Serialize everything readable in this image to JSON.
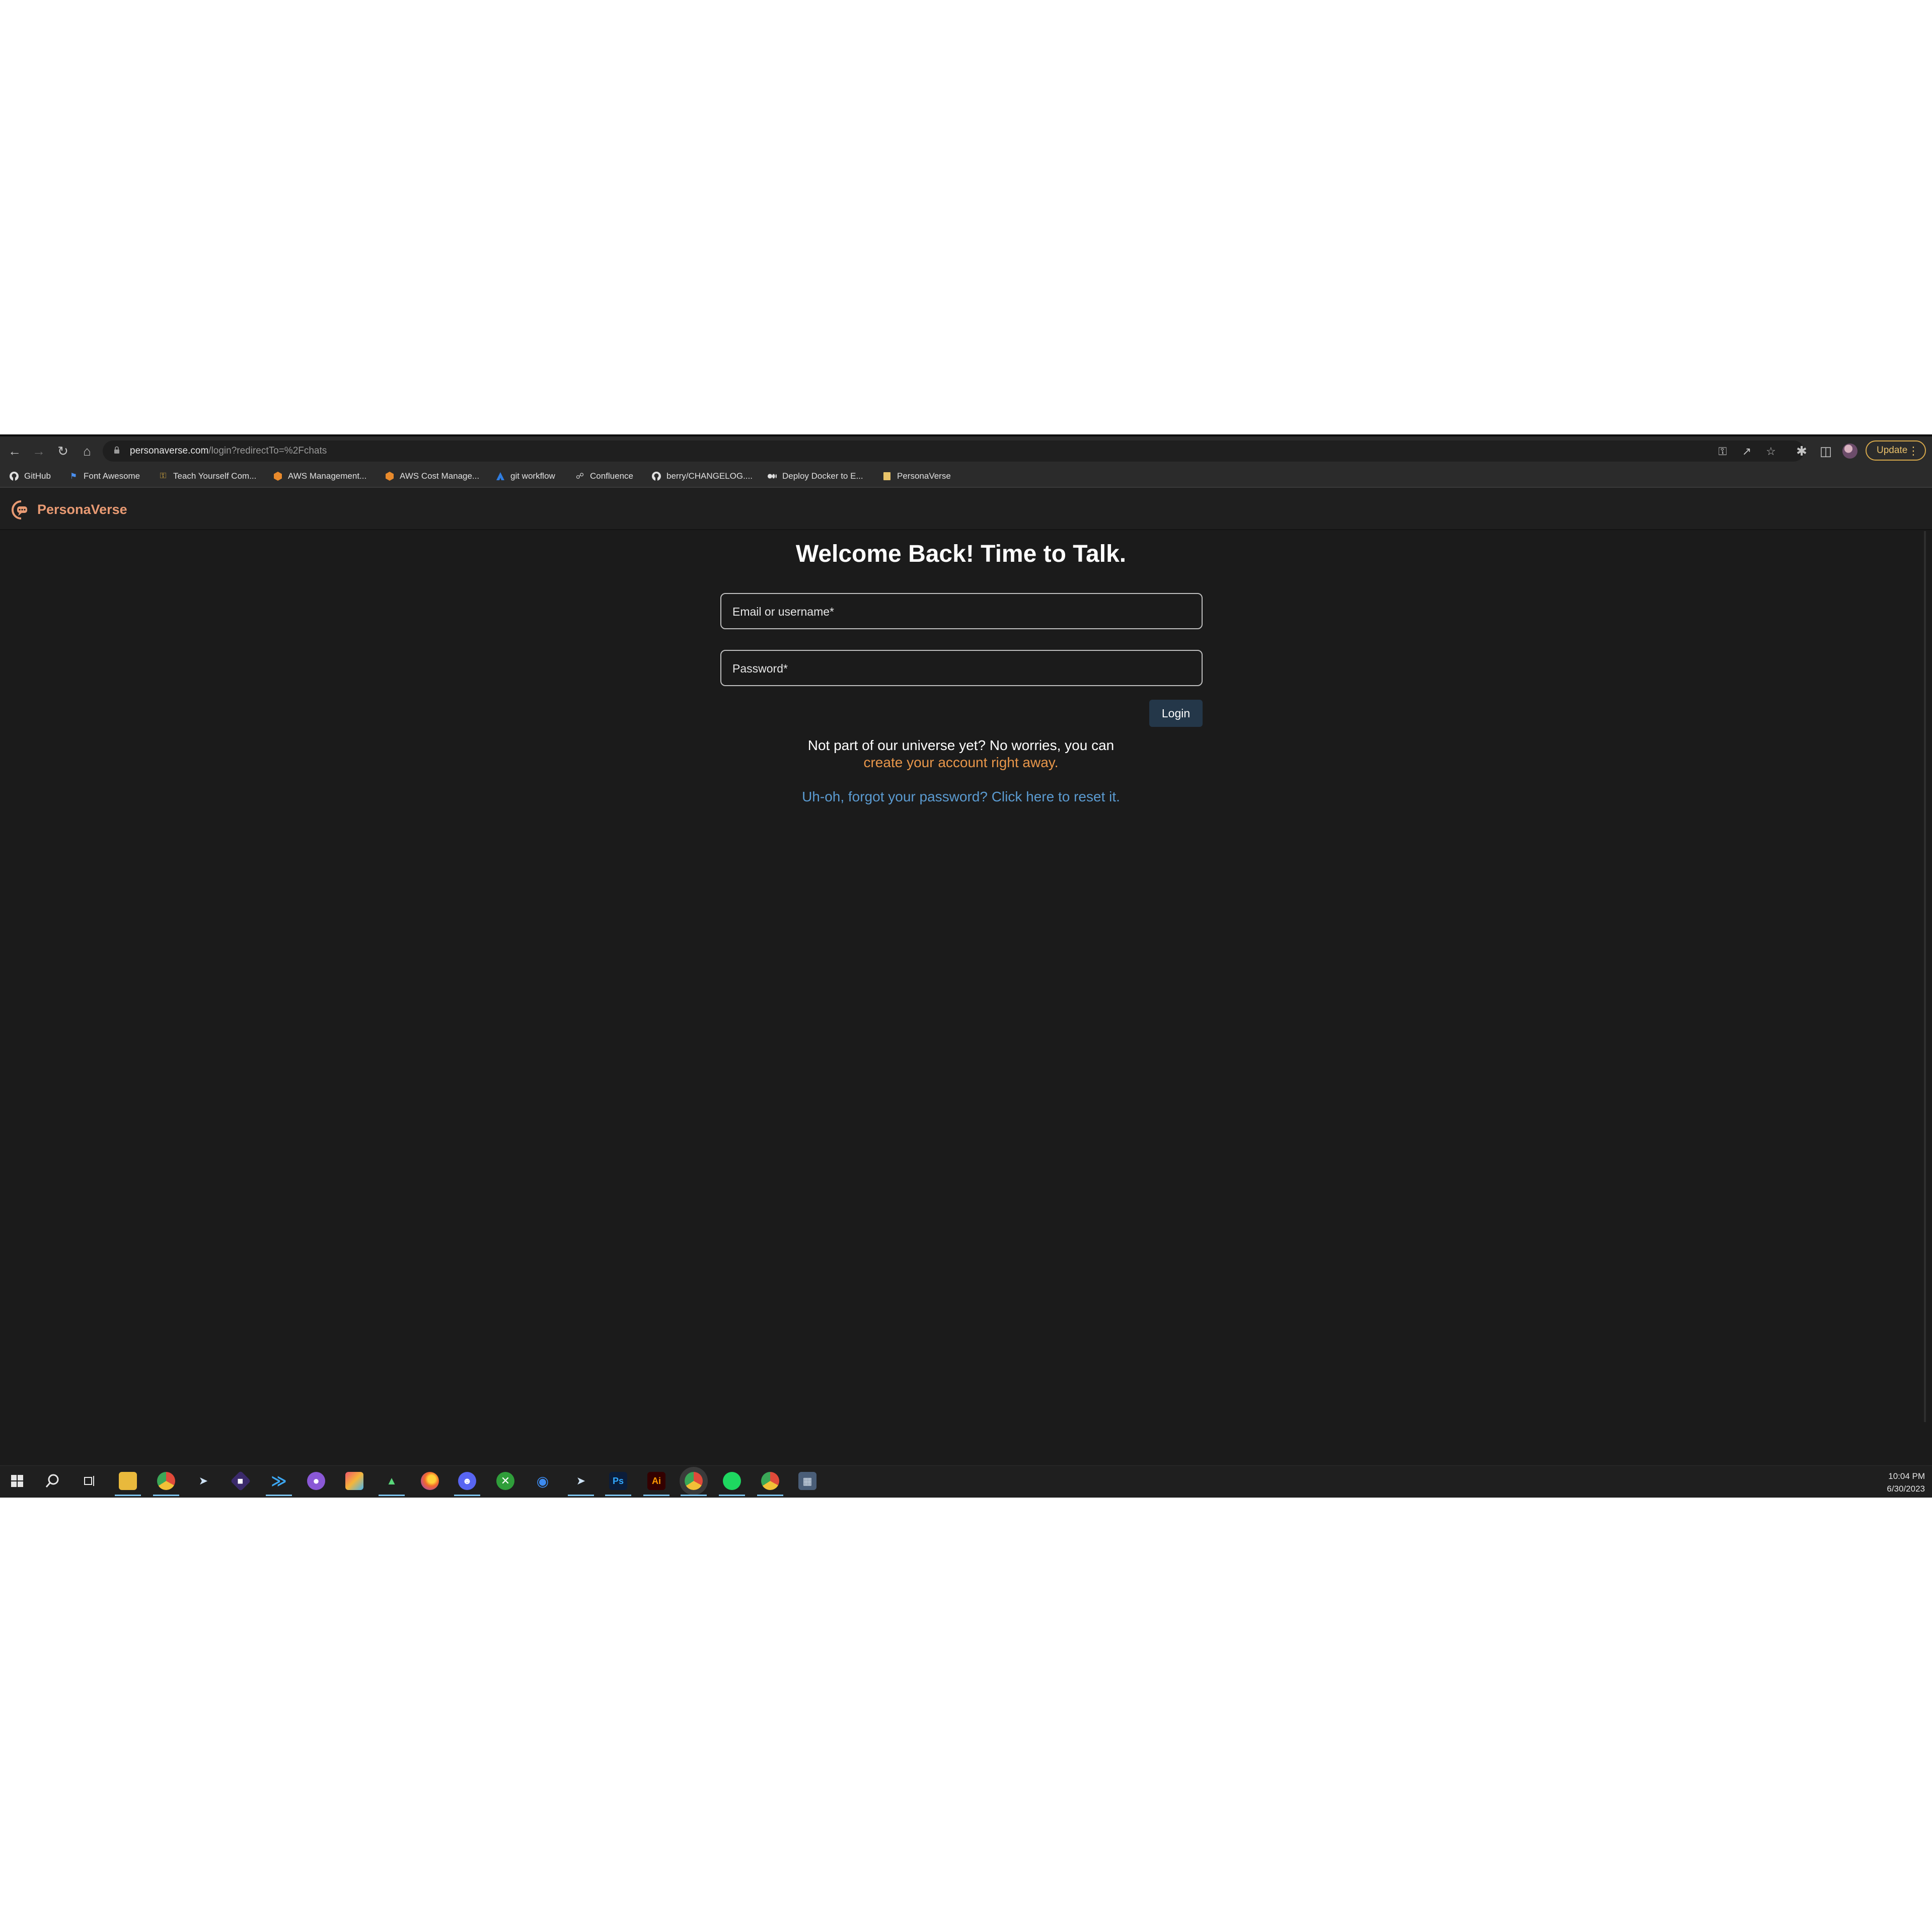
{
  "browser": {
    "url_host": "personaverse.com",
    "url_path": "/login?redirectTo=%2Fchats",
    "update_label": "Update"
  },
  "bookmarks": [
    {
      "label": "GitHub",
      "icon": "github-icon"
    },
    {
      "label": "Font Awesome",
      "icon": "flag-icon"
    },
    {
      "label": "Teach Yourself Com...",
      "icon": "key-icon"
    },
    {
      "label": "AWS Management...",
      "icon": "aws-box-icon"
    },
    {
      "label": "AWS Cost Manage...",
      "icon": "aws-box-icon"
    },
    {
      "label": "git workflow",
      "icon": "atlassian-icon"
    },
    {
      "label": "Confluence",
      "icon": "globe-icon"
    },
    {
      "label": "berry/CHANGELOG....",
      "icon": "github-icon"
    },
    {
      "label": "Deploy Docker to E...",
      "icon": "medium-icon"
    },
    {
      "label": "PersonaVerse",
      "icon": "folder-icon"
    }
  ],
  "app": {
    "brand": "PersonaVerse",
    "heading": "Welcome Back! Time to Talk.",
    "email_label": "Email or username*",
    "password_label": "Password*",
    "login_label": "Login",
    "signup_prompt": "Not part of our universe yet? No worries, you can",
    "signup_link": "create your account right away.",
    "forgot_link": "Uh-oh, forgot your password? Click here to reset it."
  },
  "colors": {
    "page_bg": "#1b1b1b",
    "brand": "#e89a73",
    "signup_link": "#e8964a",
    "forgot_link": "#5b9bd1",
    "login_button": "#243749"
  },
  "taskbar": {
    "apps": [
      "file-explorer-icon",
      "chrome-icon",
      "steam-icon",
      "git-icon",
      "vscode-icon",
      "github-desktop-icon",
      "creative-cloud-icon",
      "app-icon",
      "firefox-icon",
      "discord-icon",
      "xbox-icon",
      "maps-icon",
      "steam-icon",
      "photoshop-icon",
      "illustrator-icon",
      "chrome-icon",
      "spotify-icon",
      "chrome-icon",
      "calculator-icon"
    ],
    "time": "10:04 PM",
    "date": "6/30/2023"
  }
}
